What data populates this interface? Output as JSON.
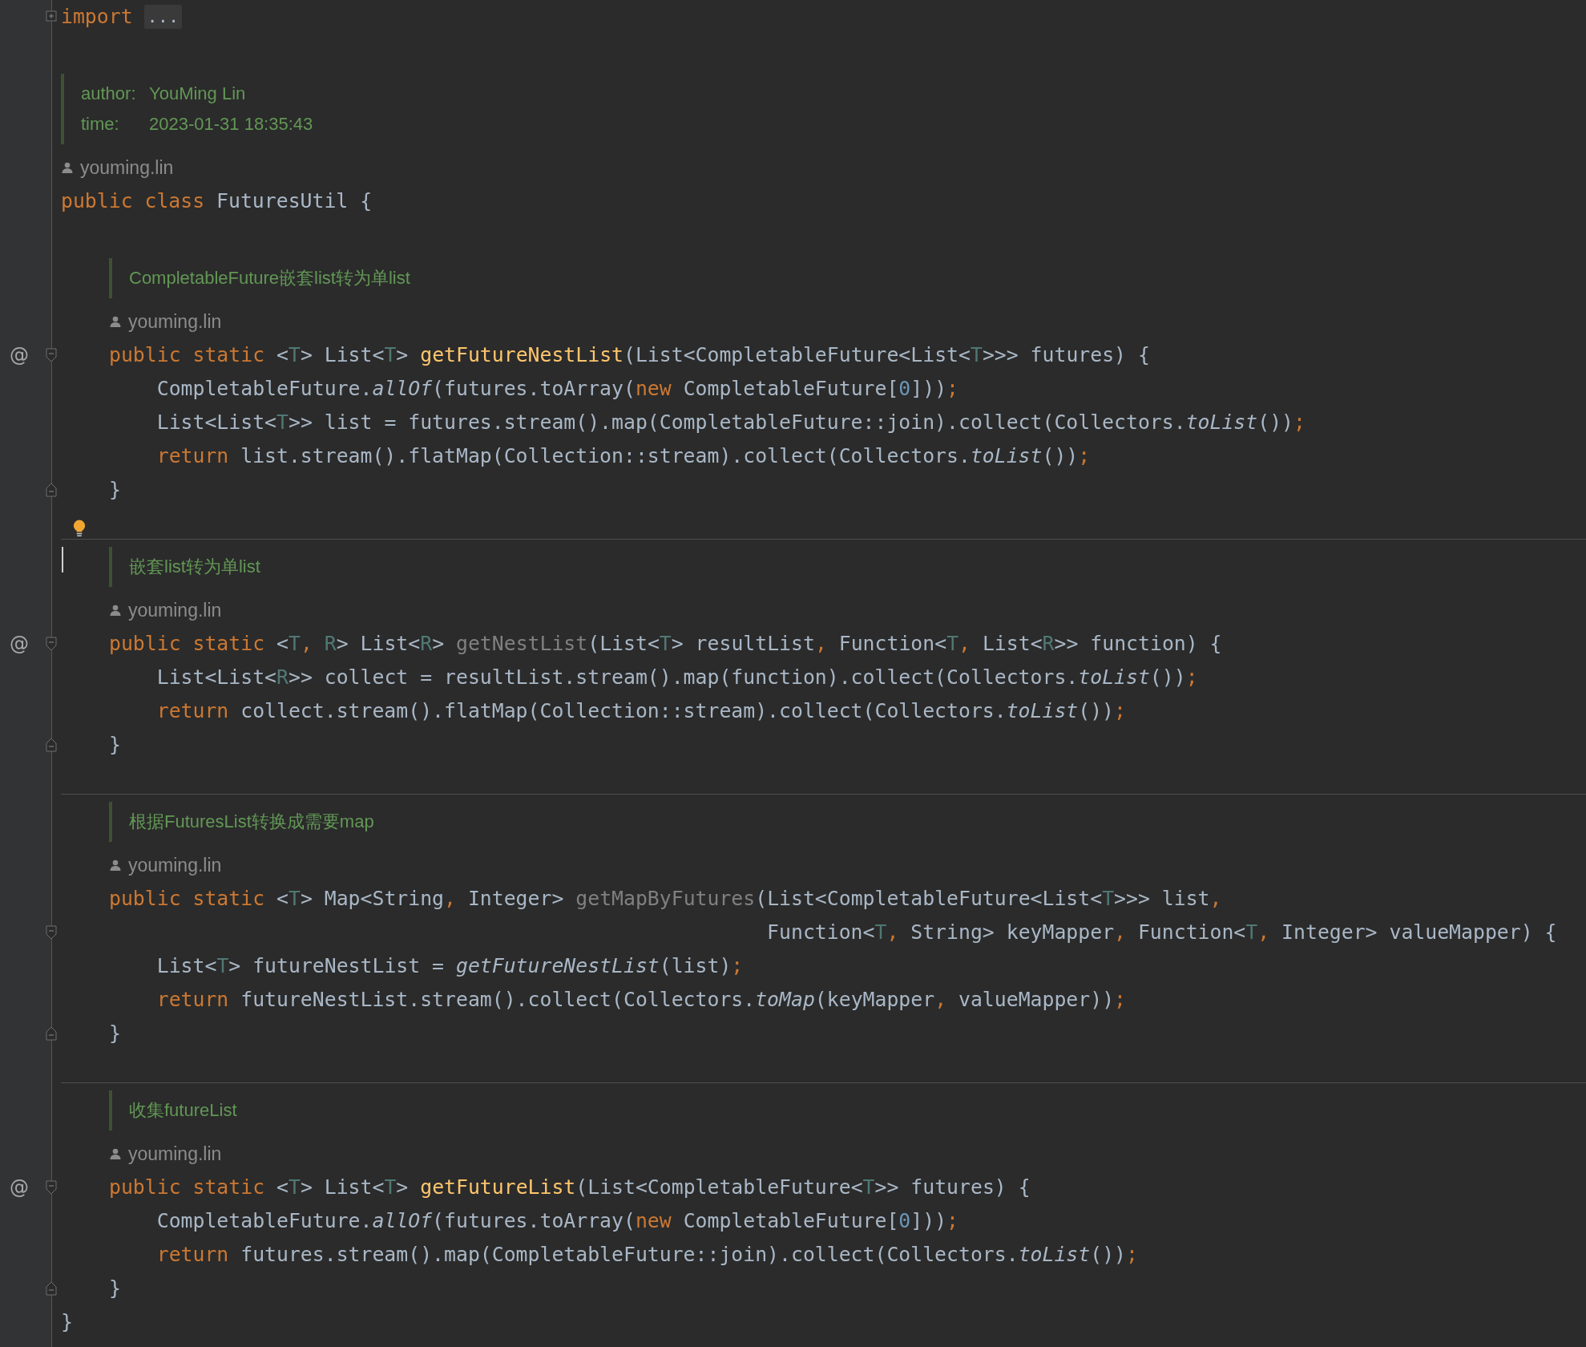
{
  "import": {
    "tokens": [
      {
        "text": "import",
        "kind": "keyword"
      }
    ],
    "folded": "...",
    "collapsed": true
  },
  "class_doc": {
    "lines": [
      {
        "label": "author:",
        "value": "YouMing Lin"
      },
      {
        "label": "time:",
        "value": "2023-01-31 18:35:43"
      }
    ]
  },
  "class_author": "youming.lin",
  "class_line": {
    "tokens": [
      {
        "text": "public class ",
        "kind": "keyword"
      },
      {
        "text": "FuturesUtil {",
        "kind": "plain"
      }
    ]
  },
  "members": [
    {
      "separator_before": false,
      "intention_bulb": false,
      "caret": false,
      "doc": "CompletableFuture嵌套list转为单list",
      "author": "youming.lin",
      "lines": [
        {
          "gutter_mark": "@",
          "fold_start": true,
          "tokens": [
            {
              "text": "public static ",
              "kind": "keyword"
            },
            {
              "text": "<",
              "kind": "plain"
            },
            {
              "text": "T",
              "kind": "type_param"
            },
            {
              "text": "> List<",
              "kind": "plain"
            },
            {
              "text": "T",
              "kind": "type_param"
            },
            {
              "text": "> ",
              "kind": "plain"
            },
            {
              "text": "getFutureNestList",
              "kind": "method_decl"
            },
            {
              "text": "(List<CompletableFuture<List<",
              "kind": "plain"
            },
            {
              "text": "T",
              "kind": "type_param"
            },
            {
              "text": ">>> futures) {",
              "kind": "plain"
            }
          ]
        },
        {
          "tokens": [
            {
              "text": "    CompletableFuture.",
              "kind": "plain"
            },
            {
              "text": "allOf",
              "kind": "static_call"
            },
            {
              "text": "(futures.toArray(",
              "kind": "plain"
            },
            {
              "text": "new",
              "kind": "keyword"
            },
            {
              "text": " CompletableFuture[",
              "kind": "plain"
            },
            {
              "text": "0",
              "kind": "number"
            },
            {
              "text": "]))",
              "kind": "plain"
            },
            {
              "text": ";",
              "kind": "punct"
            }
          ]
        },
        {
          "tokens": [
            {
              "text": "    List<List<",
              "kind": "plain"
            },
            {
              "text": "T",
              "kind": "type_param"
            },
            {
              "text": ">> list = futures.stream().map(CompletableFuture::join).collect(Collectors.",
              "kind": "plain"
            },
            {
              "text": "toList",
              "kind": "static_call"
            },
            {
              "text": "())",
              "kind": "plain"
            },
            {
              "text": ";",
              "kind": "punct"
            }
          ]
        },
        {
          "tokens": [
            {
              "text": "    return",
              "kind": "keyword"
            },
            {
              "text": " list.stream().flatMap(Collection::stream).collect(Collectors.",
              "kind": "plain"
            },
            {
              "text": "toList",
              "kind": "static_call"
            },
            {
              "text": "())",
              "kind": "plain"
            },
            {
              "text": ";",
              "kind": "punct"
            }
          ]
        },
        {
          "fold_end": true,
          "tokens": [
            {
              "text": "}",
              "kind": "plain"
            }
          ]
        }
      ]
    },
    {
      "separator_before": true,
      "intention_bulb": true,
      "caret": true,
      "doc": "嵌套list转为单list",
      "author": "youming.lin",
      "lines": [
        {
          "gutter_mark": "@",
          "fold_start": true,
          "tokens": [
            {
              "text": "public static ",
              "kind": "keyword"
            },
            {
              "text": "<",
              "kind": "plain"
            },
            {
              "text": "T",
              "kind": "type_param"
            },
            {
              "text": ", ",
              "kind": "punct"
            },
            {
              "text": "R",
              "kind": "type_param"
            },
            {
              "text": "> List<",
              "kind": "plain"
            },
            {
              "text": "R",
              "kind": "type_param"
            },
            {
              "text": "> ",
              "kind": "plain"
            },
            {
              "text": "getNestList",
              "kind": "unused"
            },
            {
              "text": "(List<",
              "kind": "plain"
            },
            {
              "text": "T",
              "kind": "type_param"
            },
            {
              "text": "> resultList",
              "kind": "plain"
            },
            {
              "text": ", ",
              "kind": "punct"
            },
            {
              "text": "Function<",
              "kind": "plain"
            },
            {
              "text": "T",
              "kind": "type_param"
            },
            {
              "text": ", ",
              "kind": "punct"
            },
            {
              "text": "List<",
              "kind": "plain"
            },
            {
              "text": "R",
              "kind": "type_param"
            },
            {
              "text": ">> function) {",
              "kind": "plain"
            }
          ]
        },
        {
          "tokens": [
            {
              "text": "    List<List<",
              "kind": "plain"
            },
            {
              "text": "R",
              "kind": "type_param"
            },
            {
              "text": ">> collect = resultList.stream().map(function).collect(Collectors.",
              "kind": "plain"
            },
            {
              "text": "toList",
              "kind": "static_call"
            },
            {
              "text": "())",
              "kind": "plain"
            },
            {
              "text": ";",
              "kind": "punct"
            }
          ]
        },
        {
          "tokens": [
            {
              "text": "    return",
              "kind": "keyword"
            },
            {
              "text": " collect.stream().flatMap(Collection::stream).collect(Collectors.",
              "kind": "plain"
            },
            {
              "text": "toList",
              "kind": "static_call"
            },
            {
              "text": "())",
              "kind": "plain"
            },
            {
              "text": ";",
              "kind": "punct"
            }
          ]
        },
        {
          "fold_end": true,
          "tokens": [
            {
              "text": "}",
              "kind": "plain"
            }
          ]
        }
      ]
    },
    {
      "separator_before": true,
      "intention_bulb": false,
      "caret": false,
      "doc": "根据FuturesList转换成需要map",
      "author": "youming.lin",
      "lines": [
        {
          "tokens": [
            {
              "text": "public static ",
              "kind": "keyword"
            },
            {
              "text": "<",
              "kind": "plain"
            },
            {
              "text": "T",
              "kind": "type_param"
            },
            {
              "text": "> Map<String",
              "kind": "plain"
            },
            {
              "text": ", ",
              "kind": "punct"
            },
            {
              "text": "Integer> ",
              "kind": "plain"
            },
            {
              "text": "getMapByFutures",
              "kind": "unused"
            },
            {
              "text": "(List<CompletableFuture<List<",
              "kind": "plain"
            },
            {
              "text": "T",
              "kind": "type_param"
            },
            {
              "text": ">>> list",
              "kind": "plain"
            },
            {
              "text": ",",
              "kind": "punct"
            }
          ]
        },
        {
          "fold_start": true,
          "tokens": [
            {
              "text": "                                                       Function<",
              "kind": "plain"
            },
            {
              "text": "T",
              "kind": "type_param"
            },
            {
              "text": ", ",
              "kind": "punct"
            },
            {
              "text": "String> keyMapper",
              "kind": "plain"
            },
            {
              "text": ", ",
              "kind": "punct"
            },
            {
              "text": "Function<",
              "kind": "plain"
            },
            {
              "text": "T",
              "kind": "type_param"
            },
            {
              "text": ", ",
              "kind": "punct"
            },
            {
              "text": "Integer> valueMapper) {",
              "kind": "plain"
            }
          ]
        },
        {
          "tokens": [
            {
              "text": "    List<",
              "kind": "plain"
            },
            {
              "text": "T",
              "kind": "type_param"
            },
            {
              "text": "> futureNestList = ",
              "kind": "plain"
            },
            {
              "text": "getFutureNestList",
              "kind": "static_call"
            },
            {
              "text": "(list)",
              "kind": "plain"
            },
            {
              "text": ";",
              "kind": "punct"
            }
          ]
        },
        {
          "tokens": [
            {
              "text": "    return",
              "kind": "keyword"
            },
            {
              "text": " futureNestList.stream().collect(Collectors.",
              "kind": "plain"
            },
            {
              "text": "toMap",
              "kind": "static_call"
            },
            {
              "text": "(keyMapper",
              "kind": "plain"
            },
            {
              "text": ", ",
              "kind": "punct"
            },
            {
              "text": "valueMapper))",
              "kind": "plain"
            },
            {
              "text": ";",
              "kind": "punct"
            }
          ]
        },
        {
          "fold_end": true,
          "tokens": [
            {
              "text": "}",
              "kind": "plain"
            }
          ]
        }
      ]
    },
    {
      "separator_before": true,
      "intention_bulb": false,
      "caret": false,
      "doc": "收集futureList",
      "author": "youming.lin",
      "lines": [
        {
          "gutter_mark": "@",
          "fold_start": true,
          "tokens": [
            {
              "text": "public static ",
              "kind": "keyword"
            },
            {
              "text": "<",
              "kind": "plain"
            },
            {
              "text": "T",
              "kind": "type_param"
            },
            {
              "text": "> List<",
              "kind": "plain"
            },
            {
              "text": "T",
              "kind": "type_param"
            },
            {
              "text": "> ",
              "kind": "plain"
            },
            {
              "text": "getFutureList",
              "kind": "method_decl"
            },
            {
              "text": "(List<CompletableFuture<",
              "kind": "plain"
            },
            {
              "text": "T",
              "kind": "type_param"
            },
            {
              "text": ">> futures) {",
              "kind": "plain"
            }
          ]
        },
        {
          "tokens": [
            {
              "text": "    CompletableFuture.",
              "kind": "plain"
            },
            {
              "text": "allOf",
              "kind": "static_call"
            },
            {
              "text": "(futures.toArray(",
              "kind": "plain"
            },
            {
              "text": "new",
              "kind": "keyword"
            },
            {
              "text": " CompletableFuture[",
              "kind": "plain"
            },
            {
              "text": "0",
              "kind": "number"
            },
            {
              "text": "]))",
              "kind": "plain"
            },
            {
              "text": ";",
              "kind": "punct"
            }
          ]
        },
        {
          "tokens": [
            {
              "text": "    return",
              "kind": "keyword"
            },
            {
              "text": " futures.stream().map(CompletableFuture::join).collect(Collectors.",
              "kind": "plain"
            },
            {
              "text": "toList",
              "kind": "static_call"
            },
            {
              "text": "())",
              "kind": "plain"
            },
            {
              "text": ";",
              "kind": "punct"
            }
          ]
        },
        {
          "fold_end": true,
          "tokens": [
            {
              "text": "}",
              "kind": "plain"
            }
          ]
        }
      ]
    }
  ],
  "class_close": {
    "tokens": [
      {
        "text": "}",
        "kind": "plain"
      }
    ]
  }
}
